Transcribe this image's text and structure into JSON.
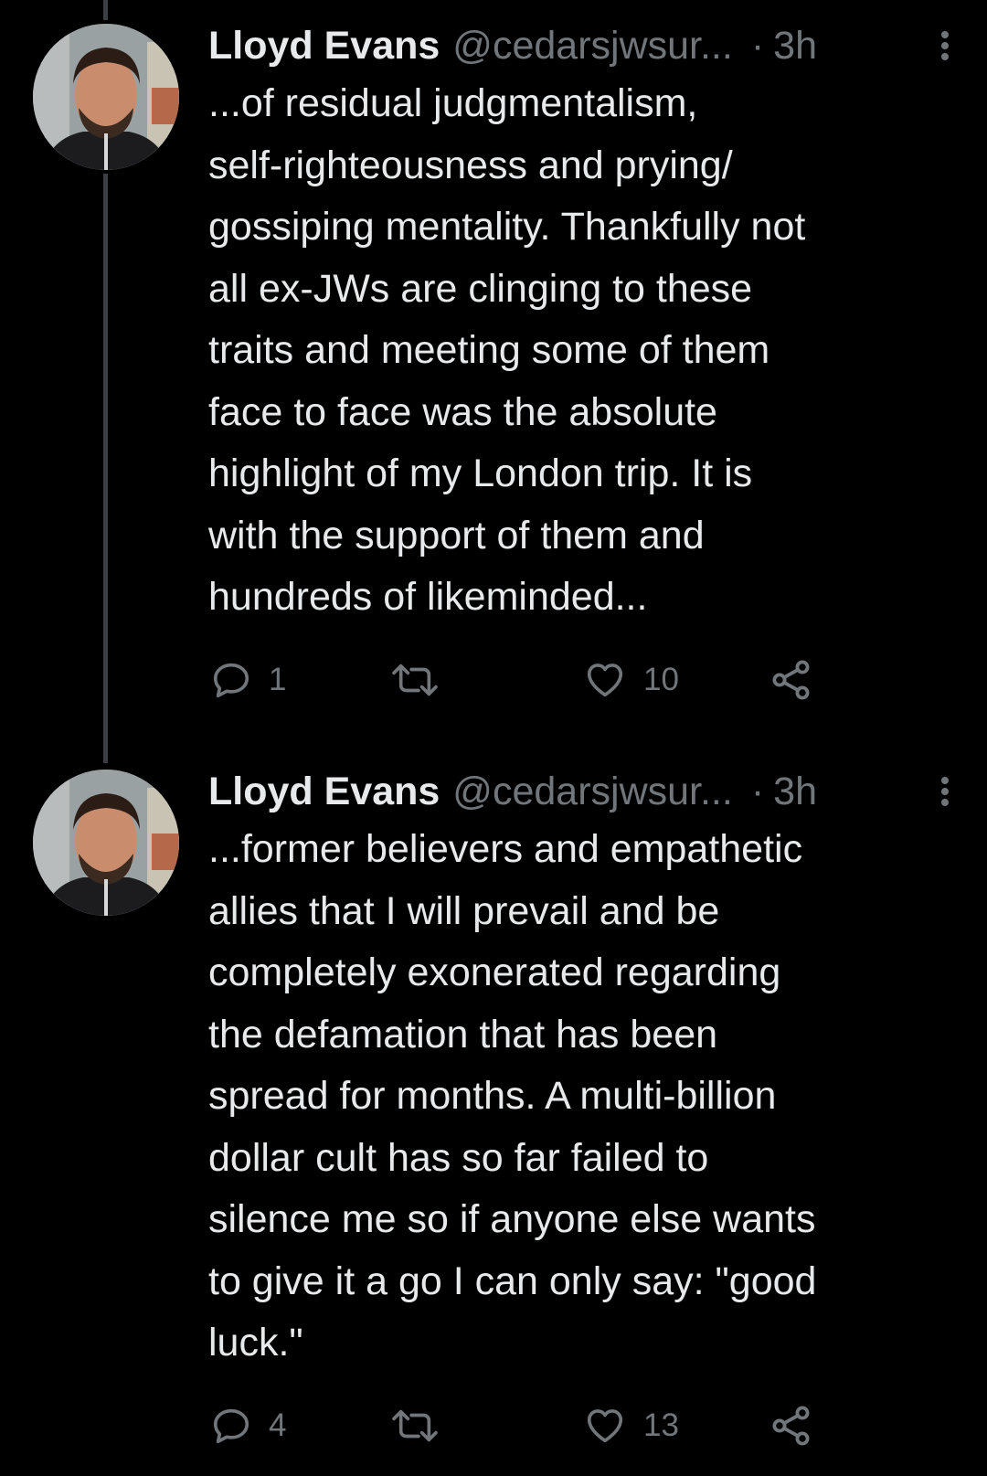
{
  "tweets": [
    {
      "name": "Lloyd Evans",
      "handle": "@cedarsjwsur...",
      "time": "3h",
      "text": "...of residual judgmentalism,\nself-righteousness and prying/\ngossiping mentality. Thankfully not\nall ex-JWs are clinging to these\ntraits and meeting some of them\nface to face was the absolute\nhighlight of my London trip. It is\nwith the support of them and\nhundreds of likeminded...",
      "replies": "1",
      "likes": "10"
    },
    {
      "name": "Lloyd Evans",
      "handle": "@cedarsjwsur...",
      "time": "3h",
      "text": "...former believers and empathetic\nallies that I will prevail and be\ncompletely exonerated regarding\nthe defamation that has been\nspread for months. A multi-billion\ndollar cult has so far failed to\nsilence me so if anyone else wants\nto give it a go I can only say: \"good\nluck.\"",
      "replies": "4",
      "likes": "13"
    }
  ],
  "icons": {
    "reply": "reply-icon",
    "retweet": "retweet-icon",
    "like": "heart-icon",
    "share": "share-icon",
    "more": "more-vertical-icon"
  },
  "colors": {
    "background": "#000000",
    "text": "#e7e9ea",
    "secondary": "#71767b",
    "thread_line": "#3b3f43"
  }
}
